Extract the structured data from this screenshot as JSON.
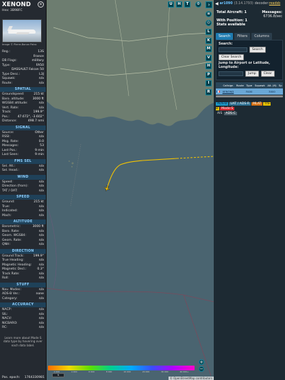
{
  "aircraft": {
    "callsign": "XENOND",
    "hex_label": "Hex: 3B98FC",
    "photo_credit": "Image © Pierre-Bonan Patro",
    "details": [
      {
        "k": "Reg.:",
        "v": "13S"
      },
      {
        "k": "",
        "v": "France"
      },
      {
        "k": "DB Flags:",
        "v": "military"
      },
      {
        "k": "Type:",
        "v": "FA50"
      },
      {
        "k": "",
        "v": "DASSAULT Falcon 50"
      },
      {
        "k": "Type Desc.:",
        "v": "L3J"
      },
      {
        "k": "Squawk:",
        "v": "n/a"
      },
      {
        "k": "Route:",
        "v": "n/a"
      }
    ]
  },
  "sections": [
    {
      "title": "SPATIAL",
      "rows": [
        {
          "k": "Groundspeed:",
          "v": "215 kt"
        },
        {
          "k": "Baro. altitude:",
          "v": "3000 ft"
        },
        {
          "k": "WGS84 altitude:",
          "v": "n/a"
        },
        {
          "k": "Vert. Rate:",
          "v": "n/a"
        },
        {
          "k": "Track:",
          "v": "199.9°"
        },
        {
          "k": "Pos.:",
          "v": "47.672°, -3.602°"
        },
        {
          "k": "Distance:",
          "v": "498.7 nmi"
        }
      ]
    },
    {
      "title": "SIGNAL",
      "rows": [
        {
          "k": "Source:",
          "v": "Other"
        },
        {
          "k": "RSSI:",
          "v": "n/a"
        },
        {
          "k": "Msg. Rate:",
          "v": "0.0"
        },
        {
          "k": "Messages:",
          "v": "53"
        },
        {
          "k": "Last Pos.:",
          "v": "9 min"
        },
        {
          "k": "Last Seen:",
          "v": "9 min"
        }
      ]
    },
    {
      "title": "FMS SEL",
      "rows": [
        {
          "k": "Sel. Alt.:",
          "v": "n/a"
        },
        {
          "k": "Sel. Head.:",
          "v": "n/a"
        }
      ]
    },
    {
      "title": "WIND",
      "rows": [
        {
          "k": "Speed:",
          "v": "n/a"
        },
        {
          "k": "Direction (from):",
          "v": "n/a"
        },
        {
          "k": "TAT / OAT:",
          "v": "n/a"
        }
      ]
    },
    {
      "title": "SPEED",
      "rows": [
        {
          "k": "Ground:",
          "v": "215 kt"
        },
        {
          "k": "True:",
          "v": "n/a"
        },
        {
          "k": "Indicated:",
          "v": "n/a"
        },
        {
          "k": "Mach:",
          "v": "n/a"
        }
      ]
    },
    {
      "title": "ALTITUDE",
      "rows": [
        {
          "k": "Barometric:",
          "v": "3000 ft"
        },
        {
          "k": "Baro. Rate:",
          "v": "n/a"
        },
        {
          "k": "Geom. WGS84:",
          "v": "n/a"
        },
        {
          "k": "Geom. Rate:",
          "v": "n/a"
        },
        {
          "k": "QNH:",
          "v": "n/a"
        }
      ]
    },
    {
      "title": "DIRECTION",
      "rows": [
        {
          "k": "Ground Track:",
          "v": "199.9°"
        },
        {
          "k": "True Heading:",
          "v": "n/a"
        },
        {
          "k": "Magnetic Heading:",
          "v": "n/a"
        },
        {
          "k": "Magnetic Decl.:",
          "v": "0.3°"
        },
        {
          "k": "Track Rate:",
          "v": "n/a"
        },
        {
          "k": "Roll:",
          "v": "n/a"
        }
      ]
    },
    {
      "title": "STUFF",
      "rows": [
        {
          "k": "Nav. Modes:",
          "v": "n/a"
        },
        {
          "k": "ADS-B Ver.:",
          "v": "none"
        },
        {
          "k": "Category:",
          "v": "n/a"
        }
      ]
    },
    {
      "title": "ACCURACY",
      "rows": [
        {
          "k": "NACP:",
          "v": "n/a"
        },
        {
          "k": "SIL:",
          "v": "n/a"
        },
        {
          "k": "NACV:",
          "v": "n/a"
        },
        {
          "k": "NICBARO:",
          "v": "n/a"
        },
        {
          "k": "RC:",
          "v": "n/a"
        }
      ]
    }
  ],
  "footnote": "Learn more about Mode S data type by hovering over each data label.",
  "epoch": {
    "k": "Pos. epoch:",
    "v": "1764330981"
  },
  "map_buttons": {
    "top": [
      "U",
      "H",
      "T"
    ],
    "side": [
      "L",
      "K",
      "M",
      "V",
      "H",
      "P",
      "I",
      "R"
    ],
    "settings_icon": "gear-icon",
    "layers_icon": "layers-icon"
  },
  "legend_ticks": [
    "2 000",
    "4 000",
    "6 000",
    "8 000",
    "10 000",
    "20 000",
    "30 000",
    "40 000+"
  ],
  "unit_btn": "ft",
  "attribution": "© OpenStreetMap contributors",
  "sidebar": {
    "top_version": "(3.14.1793)",
    "top_link": "ar1090",
    "top_decoder": "decoder:",
    "top_readsb": "readsb",
    "total_aircraft": "Total Aircraft: 1",
    "messages_label": "Messages:",
    "messages_value": "6736.8/sec",
    "with_position": "With Position: 1",
    "stats": "Stats available",
    "tabs": [
      "Search",
      "Filters",
      "Columns"
    ],
    "search_label": "Search:",
    "search_btn": "Search",
    "clear_search_btn": "Clear Search",
    "jump_label": "Jump to Airport or Latitude, Longitude:",
    "jump_btn": "Jump",
    "clear_btn": "Clear",
    "table": {
      "headers": [
        "",
        "Callsign",
        "Route",
        "Type",
        "Squawk",
        "Alt. (ft)",
        "Sp"
      ],
      "rows": [
        [
          "",
          "XENOND",
          "",
          "FA50",
          "",
          "3000",
          ""
        ]
      ]
    },
    "sources": [
      "ADS-B",
      "UAT / ADS-R",
      "MLAT",
      "TIS-B",
      "Mode-S",
      "AIS",
      "ADS-C"
    ]
  },
  "colors": {
    "track": "#f5c400",
    "land": "#6d7d70",
    "sea": "#4a6470",
    "accent": "#1f7bb0"
  }
}
